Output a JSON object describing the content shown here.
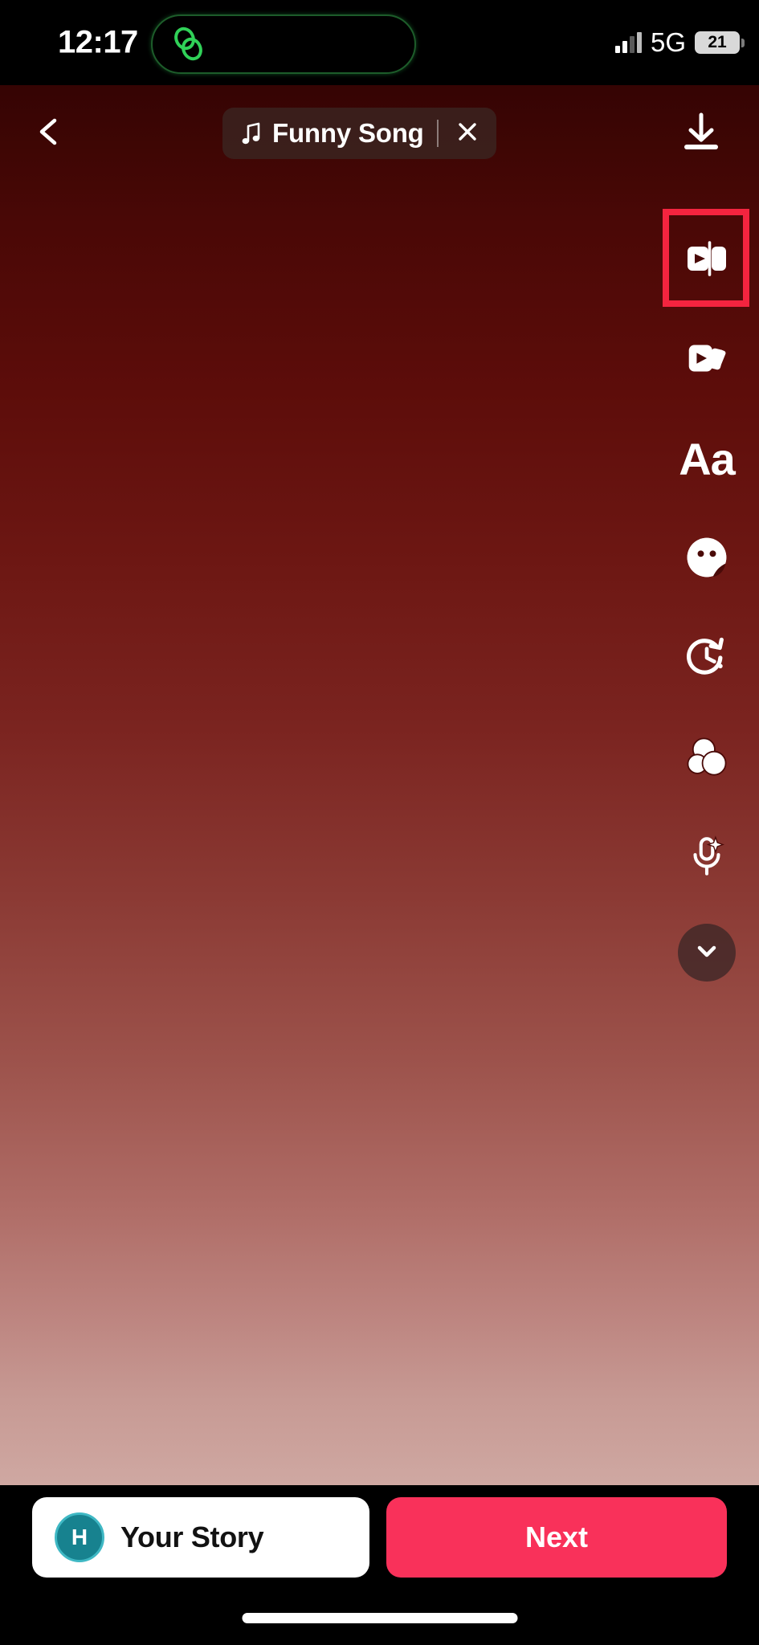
{
  "app": {
    "name": "Instagram Story Editor",
    "screen": "story-edit"
  },
  "status_bar": {
    "time": "12:17",
    "network": "5G",
    "battery_percent": "21",
    "signal_bars": 4,
    "signal_filled": 2,
    "island_icon": "link-loop-icon",
    "island_icon_color": "#30d158"
  },
  "top_bar": {
    "back_icon": "chevron-left-icon",
    "download_icon": "download-icon",
    "music": {
      "icon": "music-note-icon",
      "title": "Funny Song",
      "close_icon": "close-icon"
    }
  },
  "tool_rail": {
    "items": [
      {
        "name": "add-to-reel",
        "icon": "play-card-split-icon",
        "highlighted": true
      },
      {
        "name": "clips-stack",
        "icon": "clips-stack-icon",
        "highlighted": false
      },
      {
        "name": "text-tool",
        "icon": "text-aa-icon",
        "label": "Aa",
        "highlighted": false
      },
      {
        "name": "sticker-tool",
        "icon": "sticker-face-icon",
        "highlighted": false
      },
      {
        "name": "timer-tool",
        "icon": "clock-arrow-icon",
        "highlighted": false
      },
      {
        "name": "filters-tool",
        "icon": "three-circles-icon",
        "highlighted": false
      },
      {
        "name": "voice-effects-tool",
        "icon": "microphone-sparkle-icon",
        "highlighted": false
      }
    ],
    "collapse_icon": "chevron-down-icon",
    "highlight_color": "#f4243f"
  },
  "bottom_bar": {
    "story_button": {
      "avatar_initial": "H",
      "label": "Your Story",
      "avatar_color": "#17828f"
    },
    "next_button": {
      "label": "Next",
      "color": "#f9315a"
    }
  }
}
